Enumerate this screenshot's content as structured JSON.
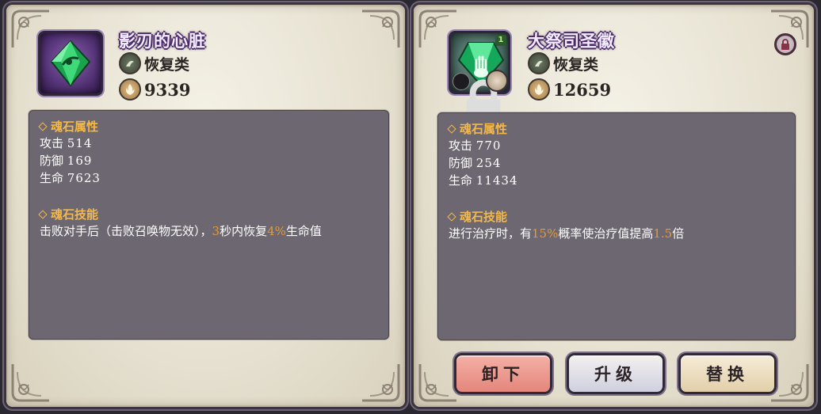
{
  "left_panel": {
    "item_name": "影刃的心脏",
    "type_label": "恢复类",
    "power": "9339",
    "gem_icon": "green-diamond-gem-icon",
    "attributes_title": "魂石属性",
    "stats": [
      {
        "label": "攻击",
        "value": "514"
      },
      {
        "label": "防御",
        "value": "169"
      },
      {
        "label": "生命",
        "value": "7623"
      }
    ],
    "skill_title": "魂石技能",
    "skill_parts": {
      "p1": "击败对手后（击败召唤物无效），",
      "h1": "3",
      "p2": "秒内恢复",
      "h2": "4%",
      "p3": "生命值"
    }
  },
  "right_panel": {
    "item_name": "大祭司圣徽",
    "type_label": "恢复类",
    "power": "12659",
    "gem_icon": "green-hand-gem-icon",
    "level_badge": "1",
    "attributes_title": "魂石属性",
    "stats": [
      {
        "label": "攻击",
        "value": "770"
      },
      {
        "label": "防御",
        "value": "254"
      },
      {
        "label": "生命",
        "value": "11434"
      }
    ],
    "skill_title": "魂石技能",
    "skill_parts": {
      "p1": "进行治疗时，有",
      "h1": "15%",
      "p2": "概率使治疗值提高",
      "h2": "1.5",
      "p3": "倍"
    },
    "buttons": {
      "unequip": "卸下",
      "upgrade": "升级",
      "replace": "替换"
    }
  },
  "colors": {
    "highlight": "#e79a31",
    "section_title": "#f4b84a",
    "title_outline": "#4b2a6a",
    "info_box": "#6c6770"
  }
}
